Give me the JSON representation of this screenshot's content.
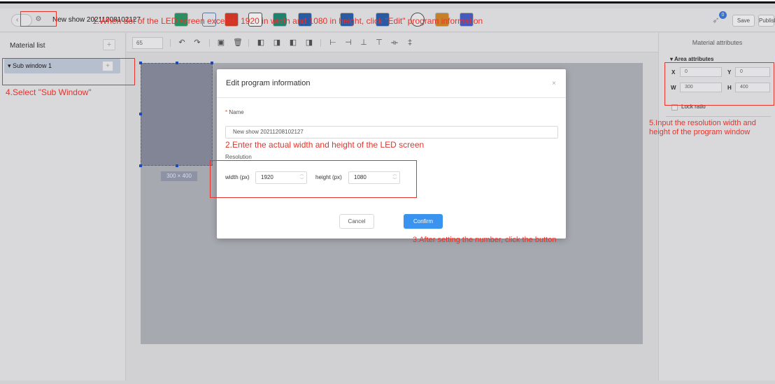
{
  "toolbar": {
    "show_title": "New show 20211208102127",
    "save_label": "Save",
    "publish_label": "Publish",
    "notification_count": "0"
  },
  "left_panel": {
    "title": "Material list",
    "add_symbol": "+",
    "sub_window_label": "▾ Sub window 1"
  },
  "edit_bar": {
    "zoom_value": "65"
  },
  "canvas": {
    "window_size_label": "300 × 400"
  },
  "right_panel": {
    "title": "Material attributes",
    "area_attributes_label": "▾ Area attributes",
    "x_label": "X",
    "x_value": "0",
    "y_label": "Y",
    "y_value": "0",
    "w_label": "W",
    "w_value": "300",
    "h_label": "H",
    "h_value": "400",
    "lock_ratio_label": "Lock ratio"
  },
  "modal": {
    "title": "Edit program information",
    "close_symbol": "×",
    "name_label": "Name",
    "required_mark": "*",
    "name_value": "New show 20211208102127",
    "resolution_label": "Resolution",
    "width_label": "width (px)",
    "width_value": "1920",
    "height_label": "height (px)",
    "height_value": "1080",
    "cancel_label": "Cancel",
    "confirm_label": "Confirm"
  },
  "annotations": {
    "step1": "1.When dot of the LED screen exceeds 1920 in width and 1080 in height, click \"Edit\" program information",
    "step2": "2.Enter the actual width and height of the LED screen",
    "step3": "3.After setting the number, click the  button",
    "step4": "4.Select \"Sub Window\"",
    "step5": "5.Input the resolution width and height of the program window"
  },
  "colors": {
    "annotation_red": "#e8322a",
    "confirm_blue": "#3a93ee",
    "selection_blue": "#2350c8"
  }
}
